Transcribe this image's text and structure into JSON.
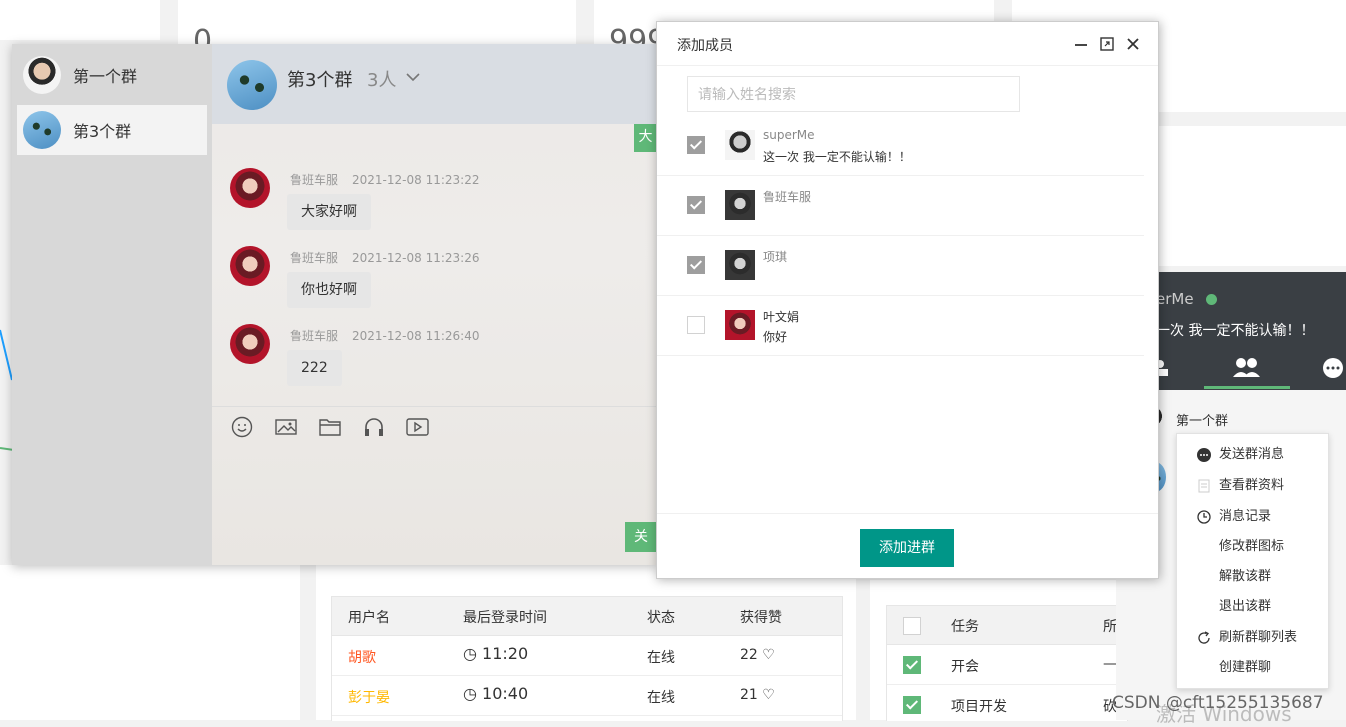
{
  "background": {
    "card_values": [
      "0",
      "999"
    ],
    "user_table": {
      "headers": [
        "用户名",
        "最后登录时间",
        "状态",
        "获得赞"
      ],
      "rows": [
        {
          "name": "胡歌",
          "time": "11:20",
          "status": "在线",
          "likes": "22",
          "color": "#FF5722"
        },
        {
          "name": "彭于晏",
          "time": "10:40",
          "status": "在线",
          "likes": "21",
          "color": "#FFB800"
        }
      ]
    },
    "task_table": {
      "headers": [
        "任务",
        "所"
      ],
      "rows": [
        {
          "task": "开会",
          "extra": "—",
          "checked": true
        },
        {
          "task": "项目开发",
          "extra": "砍",
          "checked": true
        }
      ]
    },
    "watermark": "激活 Windows",
    "credit": "CSDN @cft15255135687"
  },
  "chat": {
    "groups": [
      {
        "name": "第一个群",
        "avatar": "man-avatar"
      },
      {
        "name": "第3个群",
        "avatar": "bird-avatar",
        "active": true
      }
    ],
    "header": {
      "title": "第3个群",
      "count": "3人"
    },
    "messages": [
      {
        "sender": "鲁班车服",
        "time": "2021-12-08 11:23:22",
        "text": "大家好啊"
      },
      {
        "sender": "鲁班车服",
        "time": "2021-12-08 11:23:26",
        "text": "你也好啊"
      },
      {
        "sender": "鲁班车服",
        "time": "2021-12-08 11:26:40",
        "text": "222"
      }
    ],
    "toolbar": [
      "emoji-icon",
      "image-icon",
      "folder-icon",
      "headphone-icon",
      "video-icon"
    ],
    "top_button_label": "大",
    "close_button_label": "关"
  },
  "dialog": {
    "title": "添加成员",
    "search_placeholder": "请输入姓名搜索",
    "members": [
      {
        "name": "superMe",
        "sign": "这一次 我一定不能认输！！",
        "checked": true,
        "avatar": "man-avatar"
      },
      {
        "name": "鲁班车服",
        "sign": "",
        "checked": true,
        "avatar": "woman-avatar"
      },
      {
        "name": "项琪",
        "sign": "",
        "checked": true,
        "avatar": "woman-avatar"
      },
      {
        "name": "叶文娟",
        "sign": "你好",
        "checked": false,
        "avatar": "woman-avatar"
      }
    ],
    "submit_label": "添加进群"
  },
  "right_panel": {
    "user_name_fragment": "erMe",
    "user_sign_fragment": "一次 我一定不能认输！！",
    "group_item": "第一个群"
  },
  "context_menu": [
    {
      "label": "发送群消息",
      "icon": "chat-bubble-icon"
    },
    {
      "label": "查看群资料",
      "icon": "document-icon"
    },
    {
      "label": "消息记录",
      "icon": "clock-icon"
    },
    {
      "label": "修改群图标",
      "icon": ""
    },
    {
      "label": "解散该群",
      "icon": ""
    },
    {
      "label": "退出该群",
      "icon": ""
    },
    {
      "label": "刷新群聊列表",
      "icon": "refresh-icon"
    },
    {
      "label": "创建群聊",
      "icon": ""
    }
  ]
}
